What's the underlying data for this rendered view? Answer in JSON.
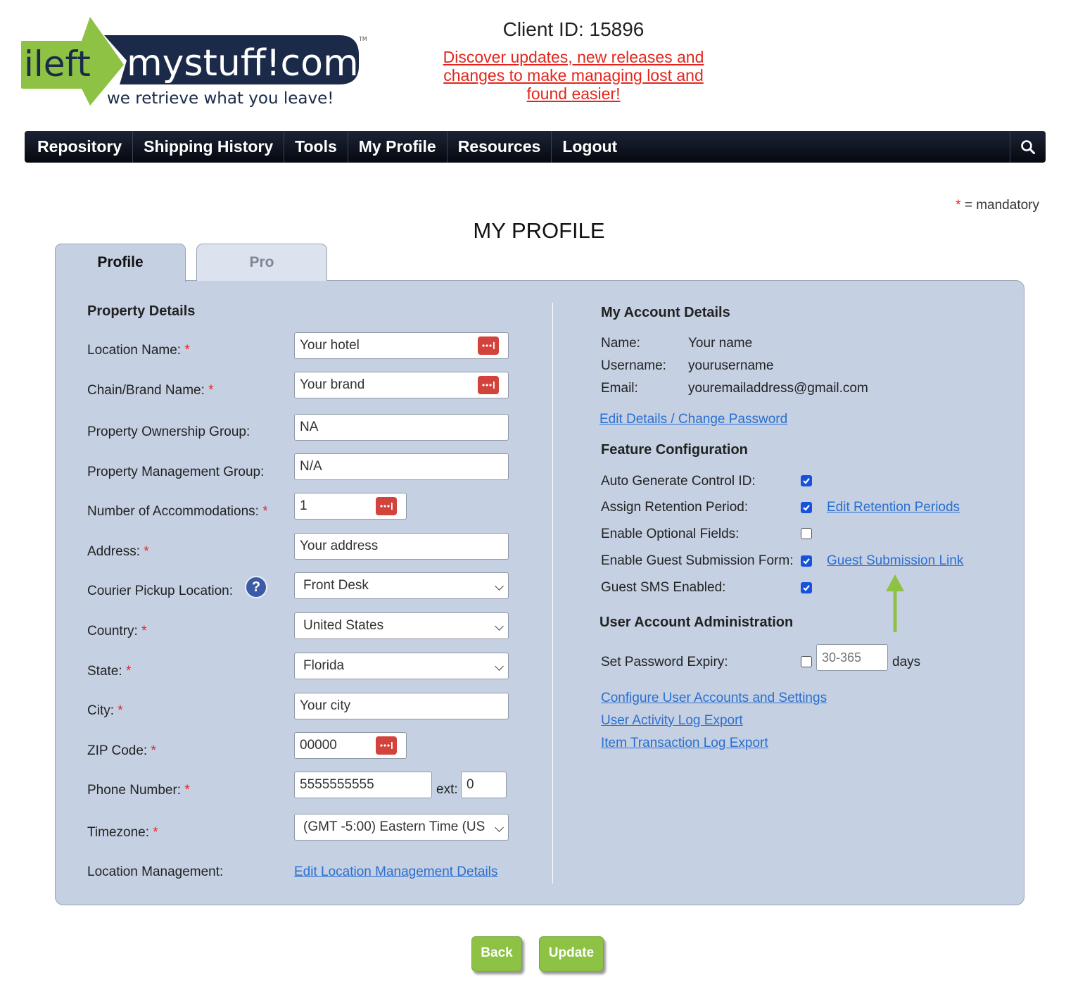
{
  "logo": {
    "left_word": "ileft",
    "right_word": "mystuff!com",
    "tagline": "we retrieve what you leave!",
    "tm": "TM"
  },
  "header": {
    "client_id": "Client ID: 15896",
    "announcement": "Discover updates, new releases and changes to make managing lost and found easier!"
  },
  "nav": {
    "items": [
      "Repository",
      "Shipping History",
      "Tools",
      "My Profile",
      "Resources",
      "Logout"
    ]
  },
  "mandatory_note": {
    "star": "*",
    "text": "= mandatory"
  },
  "page_title": "MY PROFILE",
  "tabs": {
    "profile": "Profile",
    "pro": "Pro"
  },
  "property": {
    "title": "Property Details",
    "location_name": {
      "label": "Location Name:",
      "value": "Your hotel"
    },
    "chain_brand": {
      "label": "Chain/Brand Name:",
      "value": "Your brand"
    },
    "ownership": {
      "label": "Property Ownership Group:",
      "value": "NA"
    },
    "management": {
      "label": "Property Management Group:",
      "value": "N/A"
    },
    "accommodations": {
      "label": "Number of Accommodations:",
      "value": "1"
    },
    "address": {
      "label": "Address:",
      "value": "Your address"
    },
    "courier": {
      "label": "Courier Pickup Location:",
      "value": "Front Desk",
      "help": "?"
    },
    "country": {
      "label": "Country:",
      "value": "United States"
    },
    "state": {
      "label": "State:",
      "value": "Florida"
    },
    "city": {
      "label": "City:",
      "value": "Your city"
    },
    "zip": {
      "label": "ZIP Code:",
      "value": "00000"
    },
    "phone": {
      "label": "Phone Number:",
      "value": "5555555555",
      "ext_label": "ext:",
      "ext_value": "0"
    },
    "timezone": {
      "label": "Timezone:",
      "value": "(GMT -5:00) Eastern Time (US"
    },
    "location_mgmt": {
      "label": "Location Management:",
      "link": "Edit Location Management Details"
    },
    "required_star": "*"
  },
  "account": {
    "title": "My Account Details",
    "name_label": "Name:",
    "name": "Your name",
    "username_label": "Username:",
    "username": "yourusername",
    "email_label": "Email:",
    "email": "youremailaddress@gmail.com",
    "edit_link": "Edit Details / Change Password"
  },
  "features": {
    "title": "Feature Configuration",
    "items": [
      {
        "label": "Auto Generate Control ID:",
        "checked": true,
        "link": ""
      },
      {
        "label": "Assign Retention Period:",
        "checked": true,
        "link": "Edit Retention Periods"
      },
      {
        "label": "Enable Optional Fields:",
        "checked": false,
        "link": ""
      },
      {
        "label": "Enable Guest Submission Form:",
        "checked": true,
        "link": "Guest Submission Link"
      },
      {
        "label": "Guest SMS Enabled:",
        "checked": true,
        "link": ""
      }
    ]
  },
  "admin": {
    "title": "User Account Administration",
    "password_expiry_label": "Set Password Expiry:",
    "password_expiry_checked": false,
    "password_expiry_placeholder": "30-365",
    "days": "days",
    "links": [
      "Configure User Accounts and Settings",
      "User Activity Log Export",
      "Item Transaction Log Export"
    ]
  },
  "buttons": {
    "back": "Back",
    "update": "Update"
  },
  "colors": {
    "nav_bg": "#0b101b",
    "panel_bg": "#c5d0e2",
    "required": "#e3261d",
    "link": "#2a6fd0",
    "button_green": "#8dc244",
    "checkbox_blue": "#1752dd",
    "arrow_green": "#8dc244",
    "logo_green": "#8dc244",
    "logo_navy": "#1c2a4a"
  }
}
